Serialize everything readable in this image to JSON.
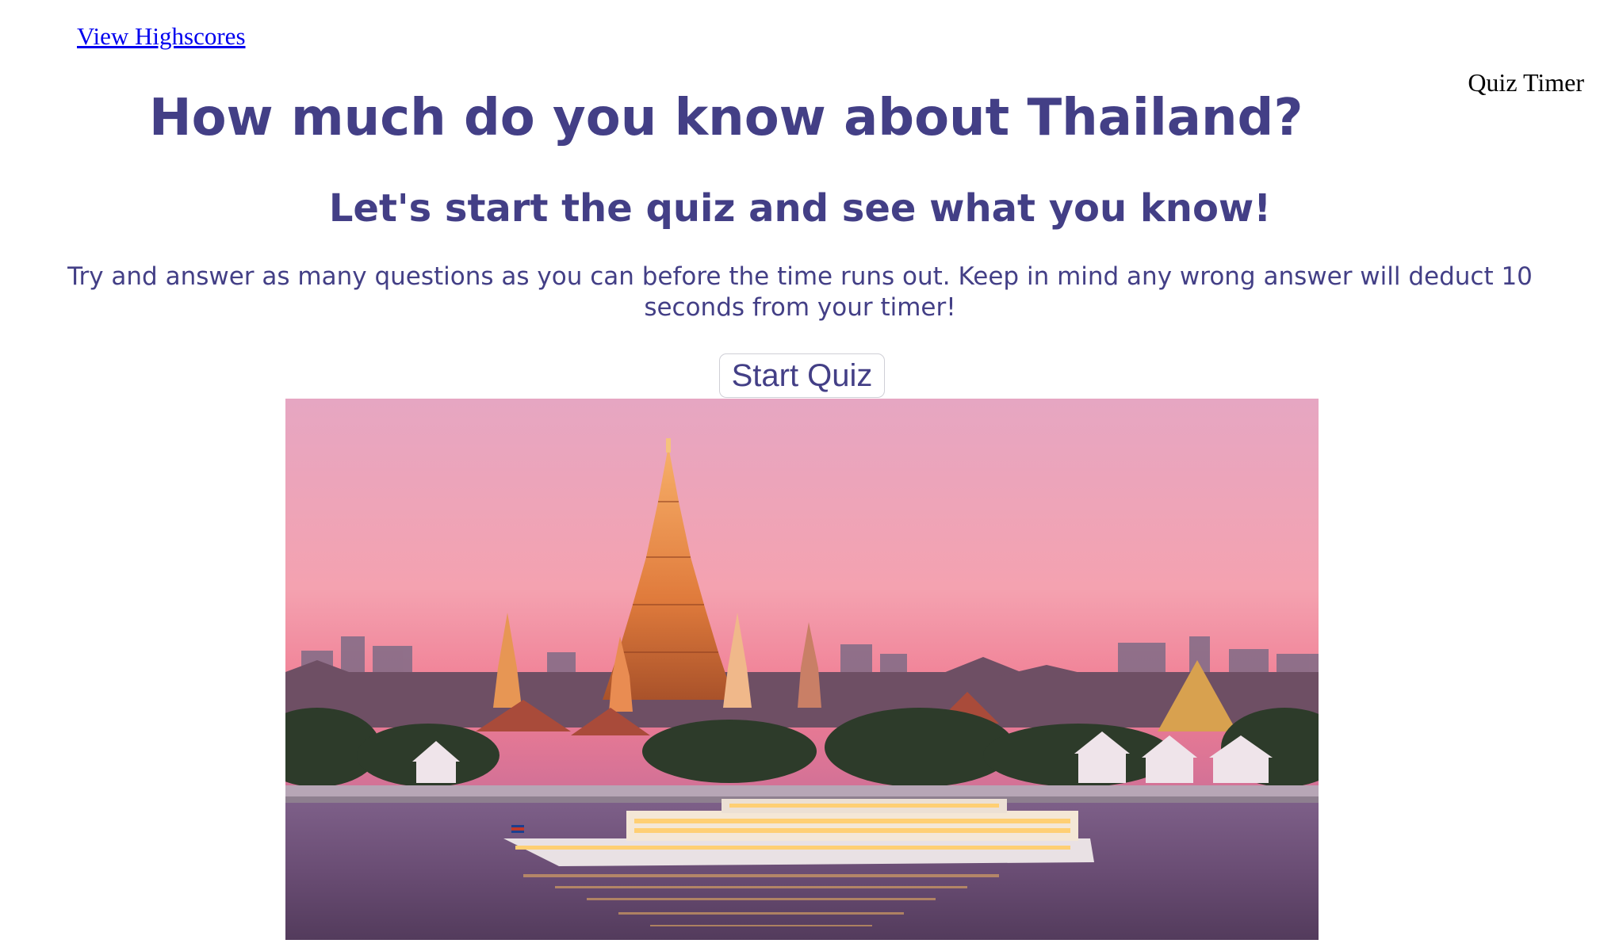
{
  "nav": {
    "highscores_label": "View Highscores"
  },
  "timer": {
    "label": "Quiz Timer"
  },
  "intro": {
    "title": "How much do you know about Thailand?",
    "subtitle": "Let's start the quiz and see what you know!",
    "instructions": "Try and answer as many questions as you can before the time runs out. Keep in mind any wrong answer will deduct 10 seconds from your timer!"
  },
  "actions": {
    "start_label": "Start Quiz"
  },
  "colors": {
    "heading": "#433f86",
    "link": "#0000ee"
  }
}
